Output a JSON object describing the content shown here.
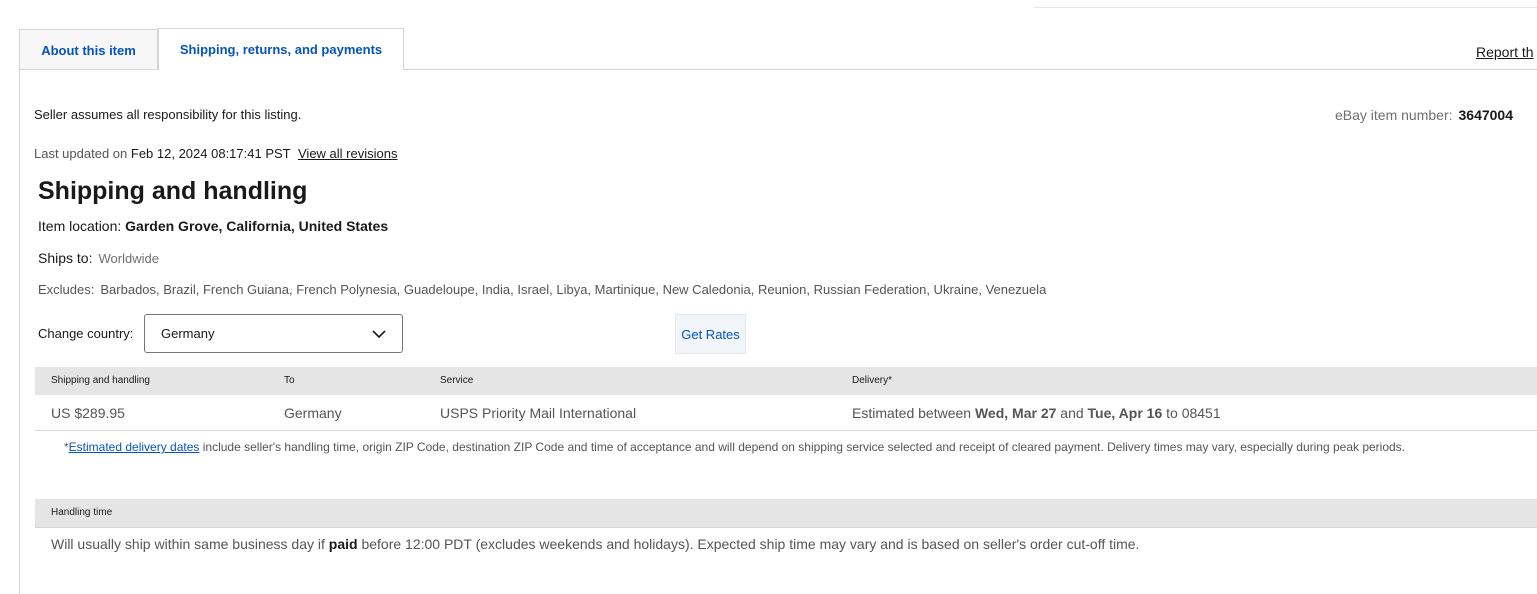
{
  "tabs": [
    {
      "label": "About this item"
    },
    {
      "label": "Shipping, returns, and payments"
    }
  ],
  "report_link": "Report th",
  "seller_note": "Seller assumes all responsibility for this listing.",
  "item_number": {
    "label": "eBay item number:",
    "value": "3647004"
  },
  "last_updated": {
    "prefix": "Last updated on",
    "date": "Feb 12, 2024 08:17:41 PST",
    "link": "View all revisions"
  },
  "shipping": {
    "title": "Shipping and handling",
    "location_label": "Item location:",
    "location_value": "Garden Grove, California, United States",
    "ships_to_label": "Ships to:",
    "ships_to_value": "Worldwide",
    "excludes_label": "Excludes:",
    "excludes_value": "Barbados, Brazil, French Guiana, French Polynesia, Guadeloupe, India, Israel, Libya, Martinique, New Caledonia, Reunion, Russian Federation, Ukraine, Venezuela",
    "change_country_label": "Change country:",
    "selected_country": "Germany",
    "get_rates_label": "Get Rates",
    "table": {
      "headers": [
        "Shipping and handling",
        "To",
        "Service",
        "Delivery*"
      ],
      "row": {
        "cost": "US $289.95",
        "to": "Germany",
        "service": "USPS Priority Mail International",
        "delivery_prefix": "Estimated between",
        "delivery_start": "Wed, Mar 27",
        "delivery_and": "and",
        "delivery_end": "Tue, Apr 16",
        "delivery_to": "to 08451"
      }
    },
    "note_star": "*",
    "note_link": "Estimated delivery dates",
    "note_text": " include seller's handling time, origin ZIP Code, destination ZIP Code and time of acceptance and will depend on shipping service selected and receipt of cleared payment. Delivery times may vary, especially during peak periods.",
    "handling_header": "Handling time",
    "handling_prefix": "Will usually ship within same business day if",
    "handling_bold": "paid",
    "handling_suffix": "before 12:00 PDT (excludes weekends and holidays). Expected ship time may vary and is based on seller's order cut-off time."
  },
  "colors": {
    "link": "#0654ba",
    "text": "#191919",
    "muted": "#555555",
    "header_bg": "#e5e5e5"
  }
}
